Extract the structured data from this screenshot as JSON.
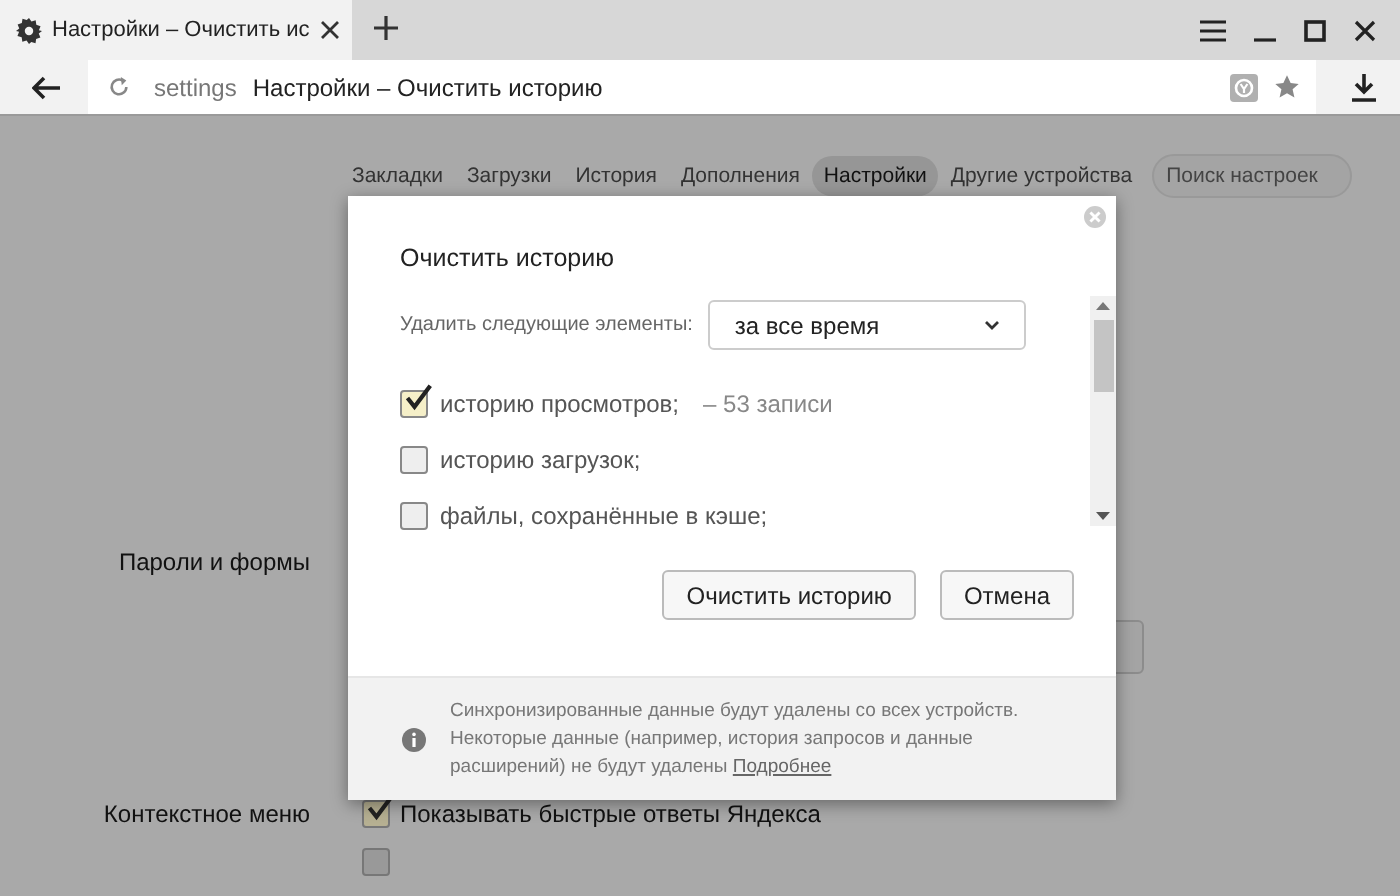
{
  "browser_tab": {
    "title": "Настройки – Очистить ис"
  },
  "address_bar": {
    "prefix": "settings",
    "text": "Настройки – Очистить историю"
  },
  "nav": {
    "items": [
      {
        "label": "Закладки",
        "selected": false
      },
      {
        "label": "Загрузки",
        "selected": false
      },
      {
        "label": "История",
        "selected": false
      },
      {
        "label": "Дополнения",
        "selected": false
      },
      {
        "label": "Настройки",
        "selected": true
      },
      {
        "label": "Другие устройства",
        "selected": false
      }
    ],
    "search": {
      "placeholder": "Поиск настроек"
    }
  },
  "sections": [
    {
      "label": "Пароли и формы"
    },
    {
      "label": "Контекстное меню",
      "checkboxes": [
        {
          "label": "Показывать быстрые ответы Яндекса",
          "checked": true
        },
        {
          "checked": false
        }
      ]
    }
  ],
  "dialog": {
    "title": "Очистить историю",
    "period_label": "Удалить следующие элементы:",
    "period_value": "за все время",
    "options": [
      {
        "label": "историю просмотров;",
        "detail": "–  53 записи",
        "checked": true
      },
      {
        "label": "историю загрузок;",
        "checked": false
      },
      {
        "label": "файлы, сохранённые в кэше;",
        "checked": false
      }
    ],
    "buttons": [
      "Очистить историю",
      "Отмена"
    ],
    "notice": {
      "text": "Синхронизированные данные будут удалены со всех устройств. Некоторые данные (например, история запросов и данные расширений) не будут удалены",
      "link": "Подробнее"
    }
  }
}
